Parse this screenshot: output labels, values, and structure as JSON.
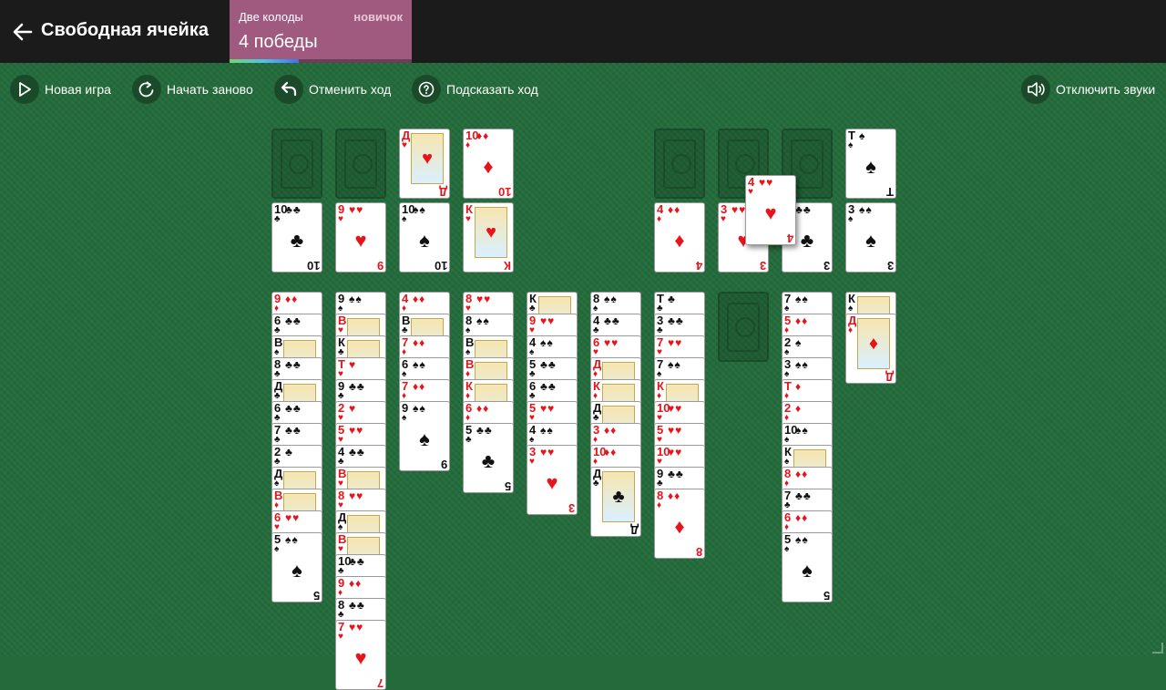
{
  "header": {
    "title": "Свободная ячейка",
    "progress": {
      "label": "Две колоды",
      "level": "новичок",
      "wins": "4 победы",
      "fraction": 0.38
    }
  },
  "toolbar": {
    "new_game": "Новая игра",
    "restart": "Начать заново",
    "undo": "Отменить ход",
    "hint": "Подсказать ход",
    "sound": "Отключить звуки"
  },
  "colors": {
    "felt": "#236b3b",
    "topbar": "#1b1b1b",
    "progress": "#a05a80",
    "red_suit": "#e8141b"
  },
  "game": {
    "freecells": [
      {
        "id": "fc1",
        "card": null
      },
      {
        "id": "fc2",
        "card": null
      },
      {
        "id": "fc3",
        "card": "Д♥"
      },
      {
        "id": "fc4",
        "card": "10♦"
      },
      {
        "id": "fc5",
        "card": null
      },
      {
        "id": "fc6",
        "card": null
      },
      {
        "id": "fc7",
        "card": null
      },
      {
        "id": "fc8",
        "card": "Т♠"
      }
    ],
    "foundations": [
      {
        "id": "f1",
        "card": "10♣"
      },
      {
        "id": "f2",
        "card": "9♥"
      },
      {
        "id": "f3",
        "card": "10♠"
      },
      {
        "id": "f4",
        "card": "К♥"
      },
      {
        "id": "f5",
        "card": "4♦"
      },
      {
        "id": "f6",
        "card": "3♥"
      },
      {
        "id": "f7",
        "card": "3♣"
      },
      {
        "id": "f8",
        "card": "3♠"
      }
    ],
    "dragging_card": "4♥",
    "tableau": [
      [
        "9♦",
        "6♣",
        "В♠",
        "8♣",
        "Д♣",
        "6♣",
        "7♣",
        "2♣",
        "Д♠",
        "В♦",
        "6♥",
        "5♠"
      ],
      [
        "9♠",
        "В♥",
        "К♣",
        "Т♥",
        "9♣",
        "2♥",
        "5♥",
        "4♣",
        "В♥",
        "8♥",
        "Д♠",
        "В♥",
        "10♣",
        "9♦",
        "8♣",
        "7♥"
      ],
      [
        "4♦",
        "В♣",
        "7♦",
        "6♠",
        "7♦",
        "9♠"
      ],
      [
        "8♥",
        "8♠",
        "В♠",
        "В♦",
        "К♦",
        "6♦",
        "5♣"
      ],
      [
        "К♣",
        "9♥",
        "4♠",
        "5♣",
        "6♣",
        "5♥",
        "4♠",
        "3♥"
      ],
      [
        "8♠",
        "4♣",
        "6♥",
        "Д♦",
        "К♦",
        "Д♣",
        "3♦",
        "10♦",
        "Д♣"
      ],
      [
        "Т♣",
        "3♣",
        "7♥",
        "7♠",
        "К♦",
        "10♥",
        "5♥",
        "10♥",
        "9♣",
        "8♦"
      ],
      [],
      [
        "7♠",
        "5♦",
        "2♠",
        "3♠",
        "Т♦",
        "2♦",
        "10♠",
        "К♠",
        "8♦",
        "7♣",
        "6♦",
        "5♠"
      ],
      [
        "К♠",
        "Д♦"
      ]
    ]
  }
}
